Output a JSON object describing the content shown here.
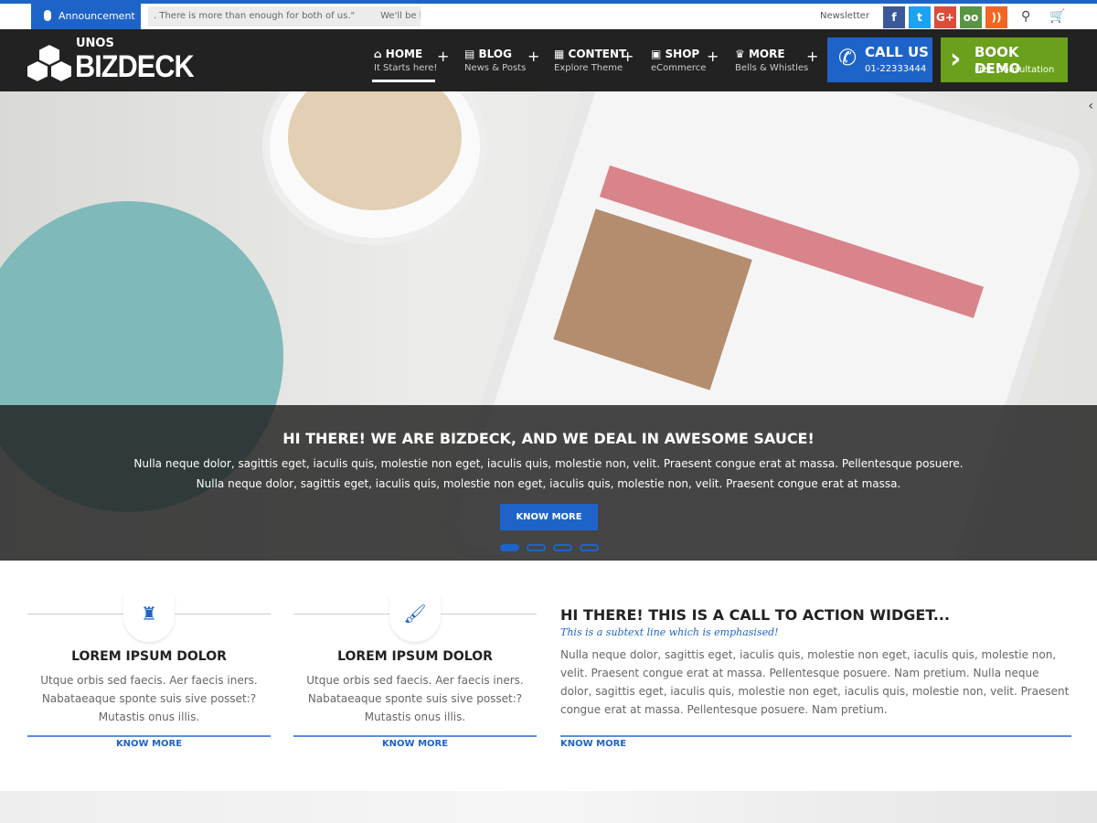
{
  "topbar": {
    "announcement": "Announcement",
    "ticker": [
      ". There is more than enough for both of us.\"",
      "We'll be h"
    ],
    "newsletter": "Newsletter",
    "social": [
      {
        "icon": "facebook-icon",
        "glyph": "f",
        "color": "#3b5998"
      },
      {
        "icon": "twitter-icon",
        "glyph": "t",
        "color": "#1da1f2"
      },
      {
        "icon": "google-plus-icon",
        "glyph": "G+",
        "color": "#dd4b39"
      },
      {
        "icon": "tripadvisor-icon",
        "glyph": "oo",
        "color": "#589442"
      },
      {
        "icon": "rss-icon",
        "glyph": "))",
        "color": "#f26522"
      }
    ]
  },
  "logo": {
    "small": "UNOS",
    "big": "BIZDECK"
  },
  "nav": [
    {
      "label": "HOME",
      "sub": "It Starts here!",
      "icon": "home-icon",
      "glyph": "⌂"
    },
    {
      "label": "BLOG",
      "sub": "News & Posts",
      "icon": "book-icon",
      "glyph": "▤"
    },
    {
      "label": "CONTENT",
      "sub": "Explore Theme",
      "icon": "file-icon",
      "glyph": "▦"
    },
    {
      "label": "SHOP",
      "sub": "eCommerce",
      "icon": "gift-icon",
      "glyph": "▣"
    },
    {
      "label": "MORE",
      "sub": "Bells & Whistles",
      "icon": "trophy-icon",
      "glyph": "♛"
    }
  ],
  "call": {
    "title": "CALL US",
    "sub": "01-22333444"
  },
  "demo": {
    "title": "BOOK DEMO",
    "sub": "Free Consultation"
  },
  "hero": {
    "title": "HI THERE! WE ARE BIZDECK, AND WE DEAL IN AWESOME SAUCE!",
    "line1": "Nulla neque dolor, sagittis eget, iaculis quis, molestie non eget, iaculis quis, molestie non, velit. Praesent congue erat at massa. Pellentesque posuere.",
    "line2": "Nulla neque dolor, sagittis eget, iaculis quis, molestie non eget, iaculis quis, molestie non, velit. Praesent congue erat at massa.",
    "button": "KNOW MORE",
    "slides": 4,
    "active_slide": 1
  },
  "features": [
    {
      "icon": "tower-icon",
      "glyph": "♜",
      "title": "LOREM IPSUM DOLOR",
      "text": "Utque orbis sed faecis. Aer faecis iners. Nabataeaque sponte suis sive posset:? Mutastis onus illis.",
      "link": "KNOW MORE"
    },
    {
      "icon": "paintbrush-icon",
      "glyph": "🖌",
      "title": "LOREM IPSUM DOLOR",
      "text": "Utque orbis sed faecis. Aer faecis iners. Nabataeaque sponte suis sive posset:? Mutastis onus illis.",
      "link": "KNOW MORE"
    }
  ],
  "cta": {
    "title": "HI THERE! THIS IS A CALL TO ACTION WIDGET...",
    "subtitle": "This is a subtext line which is emphasised!",
    "text": "Nulla neque dolor, sagittis eget, iaculis quis, molestie non eget, iaculis quis, molestie non, velit. Praesent congue erat at massa. Pellentesque posuere. Nam pretium. Nulla neque dolor, sagittis eget, iaculis quis, molestie non eget, iaculis quis, molestie non, velit. Praesent congue erat at massa. Pellentesque posuere. Nam pretium.",
    "link": "KNOW MORE"
  },
  "colors": {
    "accent": "#1e64c8",
    "green": "#6aa01c",
    "header": "#222222"
  }
}
